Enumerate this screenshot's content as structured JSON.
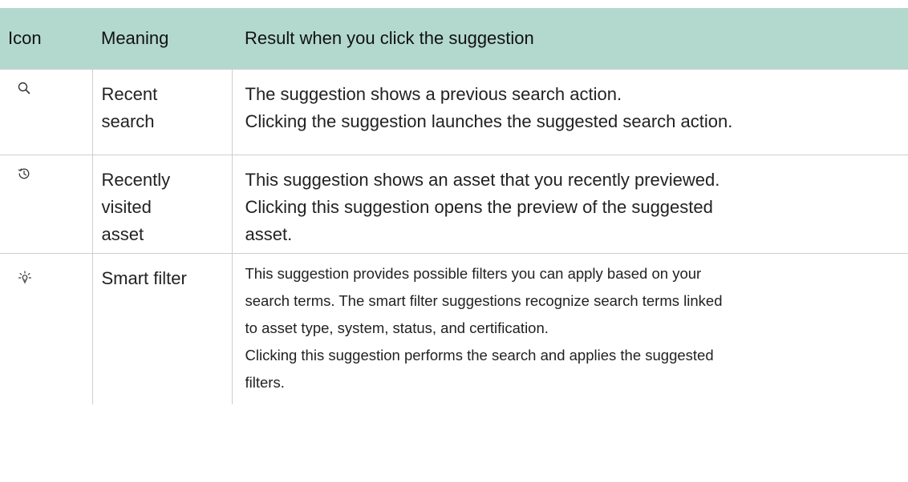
{
  "table": {
    "headers": {
      "icon": "Icon",
      "meaning": "Meaning",
      "result": "Result when you click the suggestion"
    },
    "rows": [
      {
        "icon": "search-icon",
        "meaning_lines": [
          "Recent",
          "search"
        ],
        "result_lines": [
          "The suggestion shows a previous search action.",
          "Clicking the suggestion launches the suggested search action."
        ]
      },
      {
        "icon": "history-icon",
        "meaning_lines": [
          "Recently",
          "visited",
          "asset"
        ],
        "result_lines": [
          "This suggestion shows an asset that you recently previewed.",
          "Clicking this suggestion opens the preview of the suggested",
          "asset."
        ]
      },
      {
        "icon": "lightbulb-icon",
        "meaning_lines": [
          "Smart filter"
        ],
        "result_lines": [
          "This suggestion provides possible filters you can apply based on your",
          "search terms. The smart filter suggestions recognize search terms linked",
          "to asset type, system, status, and certification.",
          "Clicking this suggestion performs the search and applies the suggested",
          "filters."
        ]
      }
    ]
  },
  "colors": {
    "header_background": "#b3d9cf",
    "border": "#cfcfcf",
    "text": "#222222"
  }
}
